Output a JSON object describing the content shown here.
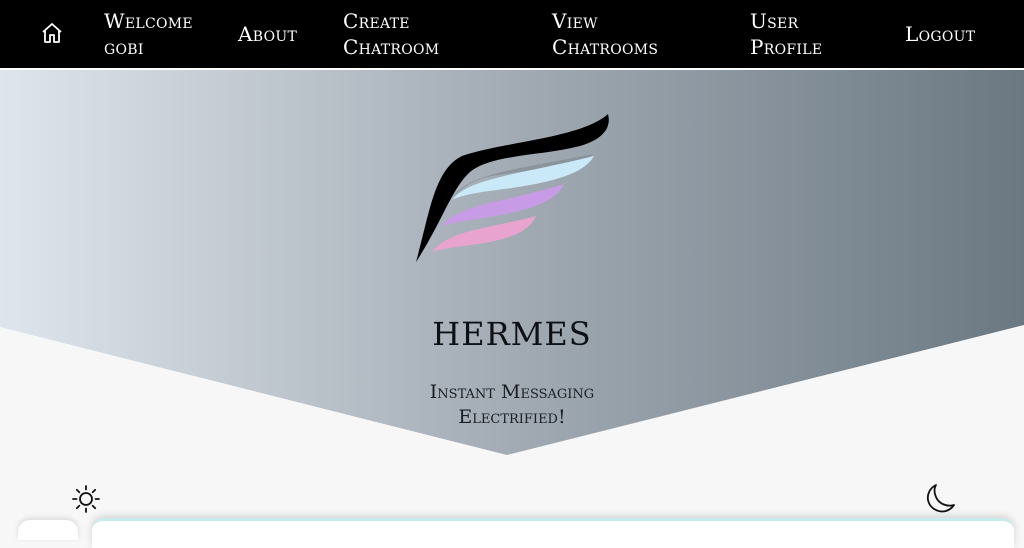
{
  "nav": {
    "home_icon": "home-icon",
    "welcome": [
      "Welcome",
      "gobi"
    ],
    "about": "About",
    "create": [
      "Create",
      "Chatroom"
    ],
    "view": [
      "View",
      "Chatrooms"
    ],
    "profile": [
      "User",
      "Profile"
    ],
    "logout": "Logout"
  },
  "hero": {
    "title": "HERMES",
    "subtitle": [
      "Instant Messaging",
      "Electrified!"
    ],
    "gradient_start": "#dfe5ec",
    "gradient_end": "#6b7882"
  },
  "theme": {
    "light_icon": "sun-icon",
    "dark_icon": "moon-icon"
  },
  "colors": {
    "navbar": "#000000",
    "background": "#f7f7f7",
    "logo_black": "#000000",
    "logo_blue": "#c9e8f8",
    "logo_purple": "#c89be6",
    "logo_pink": "#e9a3cf"
  }
}
